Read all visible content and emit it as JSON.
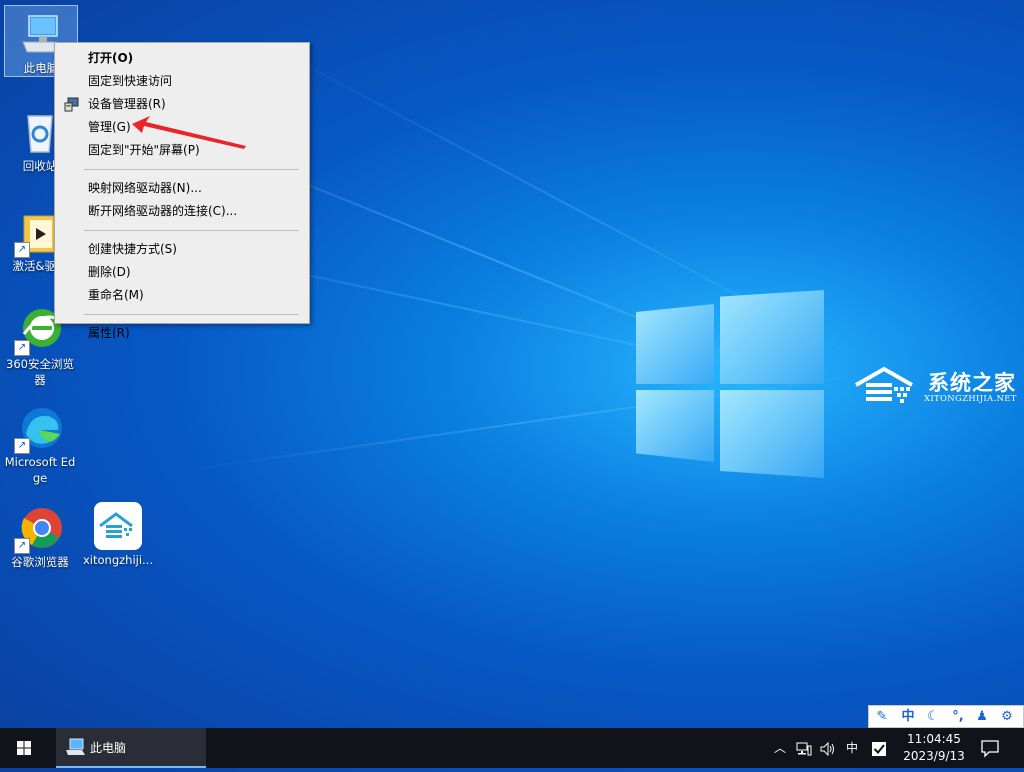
{
  "desktop": {
    "icons": [
      {
        "label": "此电脑"
      },
      {
        "label": "回收站"
      },
      {
        "label": "激活&驱动"
      },
      {
        "label": "360安全浏览器"
      },
      {
        "label": "Microsoft Edge"
      },
      {
        "label": "谷歌浏览器"
      },
      {
        "label": "xitongzhiji..."
      }
    ]
  },
  "watermark": {
    "name": "系统之家",
    "sub": "XITONGZHIJIA.NET"
  },
  "context_menu": {
    "items": [
      {
        "label": "打开(O)"
      },
      {
        "label": "固定到快速访问"
      },
      {
        "label": "设备管理器(R)"
      },
      {
        "label": "管理(G)"
      },
      {
        "label": "固定到\"开始\"屏幕(P)"
      },
      {
        "label": "映射网络驱动器(N)..."
      },
      {
        "label": "断开网络驱动器的连接(C)..."
      },
      {
        "label": "创建快捷方式(S)"
      },
      {
        "label": "删除(D)"
      },
      {
        "label": "重命名(M)"
      },
      {
        "label": "属性(R)"
      }
    ]
  },
  "taskbar": {
    "app_label": "此电脑",
    "tray": {
      "ime_label": "中"
    },
    "clock": {
      "time": "11:04:45",
      "date": "2023/9/13"
    }
  },
  "ime_bar": {
    "mode": "中"
  },
  "colors": {
    "accent": "#0a7fe0",
    "taskbar": "#10131a",
    "arrow": "#e8262a"
  }
}
